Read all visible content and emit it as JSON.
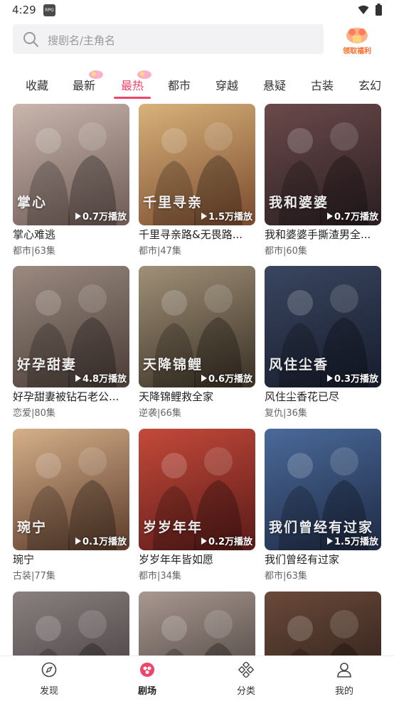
{
  "status_bar": {
    "time": "4:29",
    "app_icon_text": "RPG"
  },
  "search": {
    "placeholder": "搜剧名/主角名"
  },
  "welfare": {
    "label": "领取福利"
  },
  "tabs": [
    {
      "label": "收藏"
    },
    {
      "label": "最新"
    },
    {
      "label": "最热"
    },
    {
      "label": "都市"
    },
    {
      "label": "穿越"
    },
    {
      "label": "悬疑"
    },
    {
      "label": "古装"
    },
    {
      "label": "玄幻"
    }
  ],
  "active_tab": "最热",
  "cards": [
    {
      "title": "掌心难逃",
      "meta": "都市|63集",
      "plays": "0.7万播放",
      "overlay": "掌心",
      "c1": "#c9b7ae",
      "c2": "#6e5a55"
    },
    {
      "title": "千里寻亲路&无畏路...",
      "meta": "都市|47集",
      "plays": "1.5万播放",
      "overlay": "千里寻亲",
      "c1": "#d8b27a",
      "c2": "#7a4a2e"
    },
    {
      "title": "我和婆婆手撕渣男全...",
      "meta": "都市|60集",
      "plays": "0.7万播放",
      "overlay": "我和婆婆",
      "c1": "#6b4a4a",
      "c2": "#2a1e22"
    },
    {
      "title": "好孕甜妻被钻石老公...",
      "meta": "恋爱|80集",
      "plays": "4.8万播放",
      "overlay": "好孕甜妻",
      "c1": "#9a8a80",
      "c2": "#4a3c36"
    },
    {
      "title": "天降锦鲤救全家",
      "meta": "逆袭|66集",
      "plays": "0.6万播放",
      "overlay": "天降锦鲤",
      "c1": "#a09078",
      "c2": "#3a3024"
    },
    {
      "title": "风住尘香花已尽",
      "meta": "复仇|36集",
      "plays": "0.3万播放",
      "overlay": "风住尘香",
      "c1": "#3a4660",
      "c2": "#161c2c"
    },
    {
      "title": "琬宁",
      "meta": "古装|77集",
      "plays": "0.1万播放",
      "overlay": "琬宁",
      "c1": "#d6b08a",
      "c2": "#5a3a2a"
    },
    {
      "title": "岁岁年年皆如愿",
      "meta": "都市|34集",
      "plays": "0.2万播放",
      "overlay": "岁岁年年",
      "c1": "#c44a3a",
      "c2": "#5a1a18"
    },
    {
      "title": "我们曾经有过家",
      "meta": "都市|63集",
      "plays": "1.5万播放",
      "overlay": "我们曾经有过家",
      "c1": "#4a6a9a",
      "c2": "#1e2a44"
    },
    {
      "title": "",
      "meta": "",
      "plays": "",
      "overlay": "",
      "c1": "#8a8080",
      "c2": "#3a3434"
    },
    {
      "title": "",
      "meta": "",
      "plays": "",
      "overlay": "",
      "c1": "#a89890",
      "c2": "#3c3430"
    },
    {
      "title": "",
      "meta": "",
      "plays": "",
      "overlay": "",
      "c1": "#6a4a3a",
      "c2": "#241814"
    }
  ],
  "bottom_nav": [
    {
      "label": "发现",
      "icon": "compass-icon"
    },
    {
      "label": "剧场",
      "icon": "theater-icon"
    },
    {
      "label": "分类",
      "icon": "category-icon"
    },
    {
      "label": "我的",
      "icon": "profile-icon"
    }
  ],
  "colors": {
    "accent": "#f0456a"
  }
}
